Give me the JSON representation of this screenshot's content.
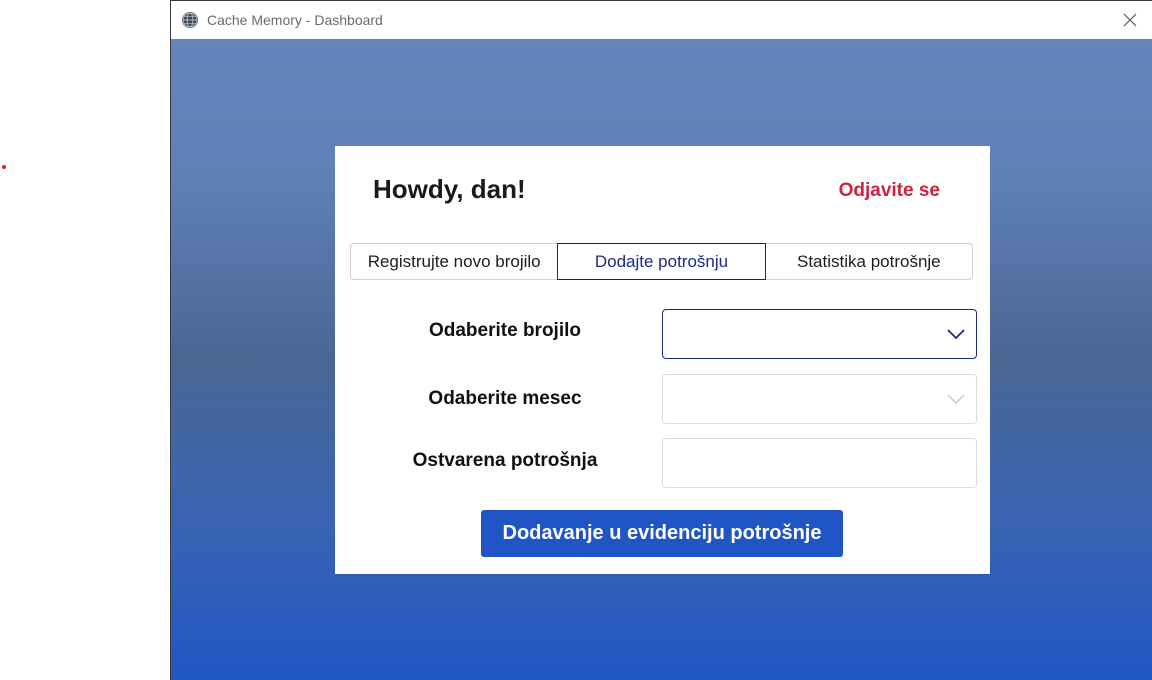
{
  "window": {
    "title": "Cache Memory - Dashboard",
    "app_icon": "globe-icon",
    "close_icon": "close-icon"
  },
  "card": {
    "greeting": "Howdy, dan!",
    "logout_label": "Odjavite se",
    "tabs": [
      {
        "label": "Registrujte novo brojilo",
        "active": false
      },
      {
        "label": "Dodajte potrošnju",
        "active": true
      },
      {
        "label": "Statistika potrošnje",
        "active": false
      }
    ],
    "form": {
      "meter_label": "Odaberite brojilo",
      "meter_value": "",
      "month_label": "Odaberite mesec",
      "month_value": "",
      "consumption_label": "Ostvarena potrošnja",
      "consumption_value": "",
      "submit_label": "Dodavanje u evidenciju potrošnje"
    }
  },
  "colors": {
    "accent": "#2055c5",
    "logout": "#d0233e",
    "active_tab_border": "#1b1b8a",
    "gradient_top": "#6585bc",
    "gradient_bottom": "#2157c4"
  }
}
